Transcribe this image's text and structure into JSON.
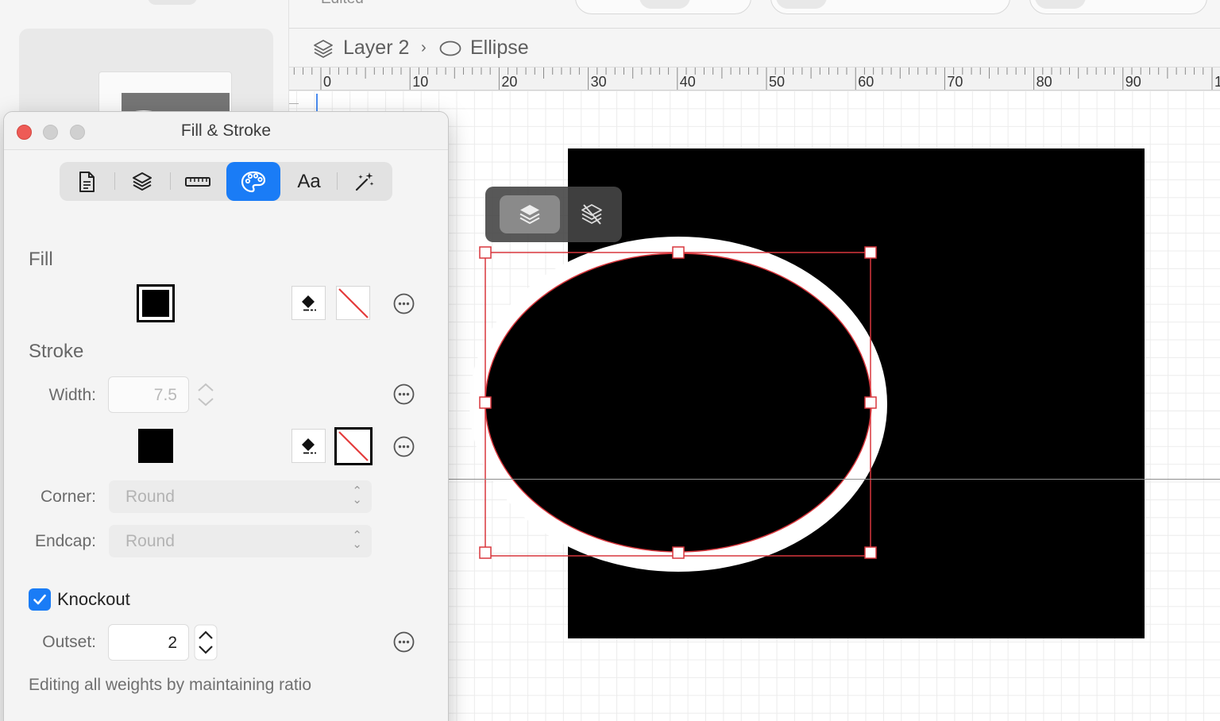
{
  "document": {
    "subtitle": "Edited"
  },
  "breadcrumb": {
    "layer": "Layer 2",
    "separator": "›",
    "shape": "Ellipse"
  },
  "ruler": {
    "labels": [
      "0",
      "10",
      "20",
      "30",
      "40",
      "50",
      "60",
      "70",
      "80",
      "90",
      "1"
    ]
  },
  "inspector": {
    "title": "Fill & Stroke",
    "tabs": [
      {
        "name": "document",
        "icon": "document-icon"
      },
      {
        "name": "layers",
        "icon": "layers-icon"
      },
      {
        "name": "measure",
        "icon": "ruler-icon"
      },
      {
        "name": "fill-stroke",
        "icon": "palette-icon",
        "active": true
      },
      {
        "name": "text",
        "label": "Aa"
      },
      {
        "name": "effects",
        "icon": "magic-wand-icon"
      }
    ],
    "fill": {
      "label": "Fill",
      "color": "#000000"
    },
    "stroke": {
      "label": "Stroke",
      "width_label": "Width:",
      "width_value": "7.5",
      "color": "#000000",
      "corner_label": "Corner:",
      "corner_value": "Round",
      "endcap_label": "Endcap:",
      "endcap_value": "Round"
    },
    "knockout": {
      "label": "Knockout",
      "checked": true,
      "outset_label": "Outset:",
      "outset_value": "2"
    },
    "hint": "Editing all weights by maintaining ratio"
  },
  "colors": {
    "accent": "#1a7cf6",
    "selection": "#d8373d",
    "close": "#ee5b56"
  }
}
